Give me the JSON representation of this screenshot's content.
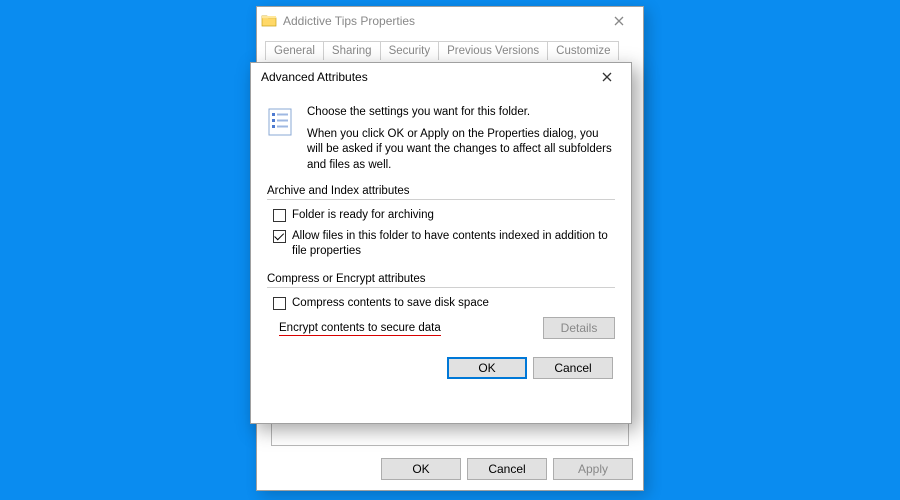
{
  "parent": {
    "title": "Addictive Tips Properties",
    "tabs": [
      "General",
      "Sharing",
      "Security",
      "Previous Versions",
      "Customize"
    ],
    "active_tab_index": 0,
    "buttons": {
      "ok": "OK",
      "cancel": "Cancel",
      "apply": "Apply"
    }
  },
  "adv": {
    "title": "Advanced Attributes",
    "intro_line1": "Choose the settings you want for this folder.",
    "intro_line2": "When you click OK or Apply on the Properties dialog, you will be asked if you want the changes to affect all subfolders and files as well.",
    "group1_label": "Archive and Index attributes",
    "cb_archive": {
      "label": "Folder is ready for archiving",
      "checked": false
    },
    "cb_index": {
      "label": "Allow files in this folder to have contents indexed in addition to file properties",
      "checked": true
    },
    "group2_label": "Compress or Encrypt attributes",
    "cb_compress": {
      "label": "Compress contents to save disk space",
      "checked": false
    },
    "cb_encrypt": {
      "label": "Encrypt contents to secure data",
      "checked": true
    },
    "details_label": "Details",
    "buttons": {
      "ok": "OK",
      "cancel": "Cancel"
    }
  }
}
